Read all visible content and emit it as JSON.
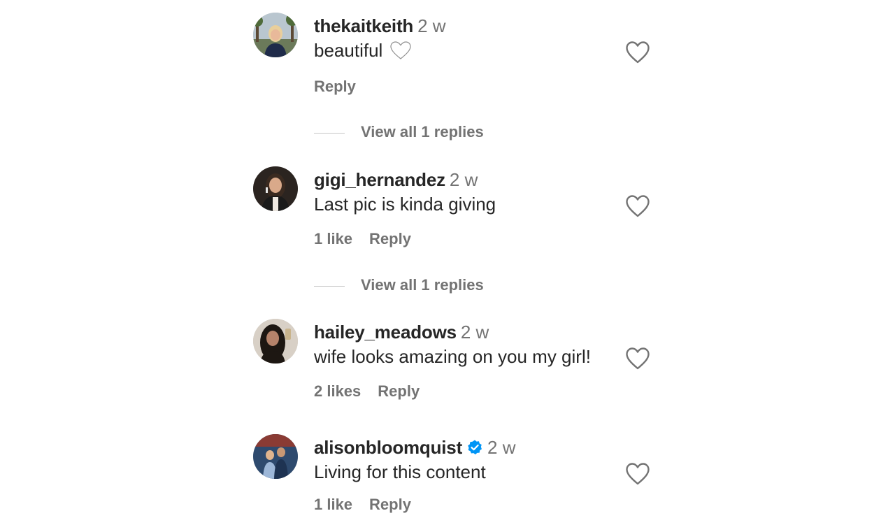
{
  "comments": [
    {
      "username": "thekaitkeith",
      "time": "2 w",
      "text": "beautiful",
      "inline_emoji": "white-heart-icon",
      "likes": "",
      "reply_label": "Reply",
      "view_replies": "View all 1 replies"
    },
    {
      "username": "gigi_hernandez",
      "time": "2 w",
      "text": "Last pic is kinda giving",
      "likes": "1 like",
      "reply_label": "Reply",
      "view_replies": "View all 1 replies"
    },
    {
      "username": "hailey_meadows",
      "time": "2 w",
      "text": "wife looks amazing on you my girl!",
      "likes": "2 likes",
      "reply_label": "Reply"
    },
    {
      "username": "alisonbloomquist",
      "verified": true,
      "time": "2 w",
      "text": "Living for this content",
      "likes": "1 like",
      "reply_label": "Reply"
    }
  ],
  "colors": {
    "text": "#262626",
    "secondary": "#737373",
    "verified": "#0095f6",
    "background": "#ffffff"
  },
  "icons": {
    "like": "heart-outline-icon",
    "verified": "verified-badge-icon"
  }
}
